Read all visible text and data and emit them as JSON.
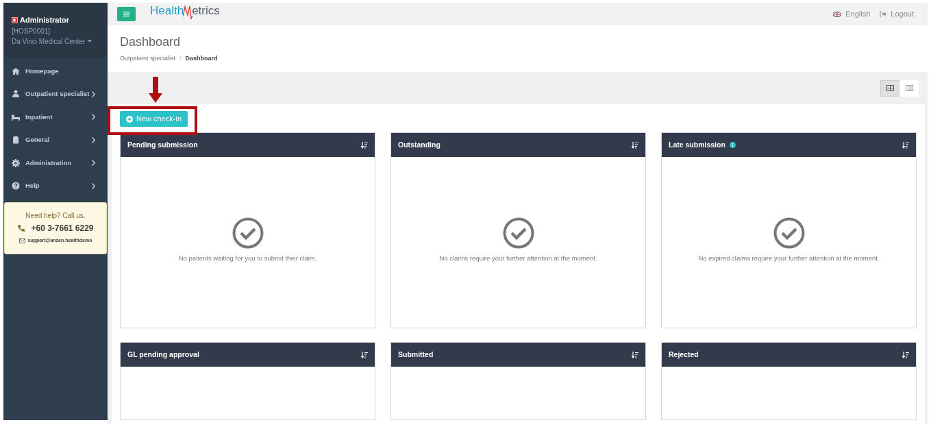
{
  "user": {
    "name": "Administrator",
    "code": "[HOSP0001]",
    "hospital": "Da Vinci Medical Center"
  },
  "sidebar": {
    "items": [
      {
        "label": "Homepage",
        "expandable": false
      },
      {
        "label": "Outpatient specialist",
        "expandable": true
      },
      {
        "label": "Inpatient",
        "expandable": true
      },
      {
        "label": "General",
        "expandable": true
      },
      {
        "label": "Administration",
        "expandable": true
      },
      {
        "label": "Help",
        "expandable": true
      }
    ]
  },
  "help_box": {
    "title": "Need help? Call us.",
    "phone": "+60 3-7661 6229",
    "email": "support@anzen.healthdemo"
  },
  "topbar": {
    "logo_left": "Health",
    "logo_right": "etrics",
    "language": "English",
    "logout": "Logout"
  },
  "page": {
    "title": "Dashboard",
    "breadcrumb": [
      "Outpatient specialist",
      "Dashboard"
    ],
    "breadcrumb_separator": "/"
  },
  "view_toggle": [
    {
      "kind": "grid",
      "selected": true
    },
    {
      "kind": "list",
      "selected": false
    }
  ],
  "new_button": "New check-in",
  "cards": [
    {
      "title": "Pending submission",
      "info": false,
      "message": "No patients waiting for you to submit their claim."
    },
    {
      "title": "Outstanding",
      "info": false,
      "message": "No claims require your further attention at the moment."
    },
    {
      "title": "Late submission",
      "info": true,
      "message": "No expired claims require your further attention at the moment."
    },
    {
      "title": "GL pending approval",
      "info": false
    },
    {
      "title": "Submitted",
      "info": false
    },
    {
      "title": "Rejected",
      "info": false
    }
  ]
}
